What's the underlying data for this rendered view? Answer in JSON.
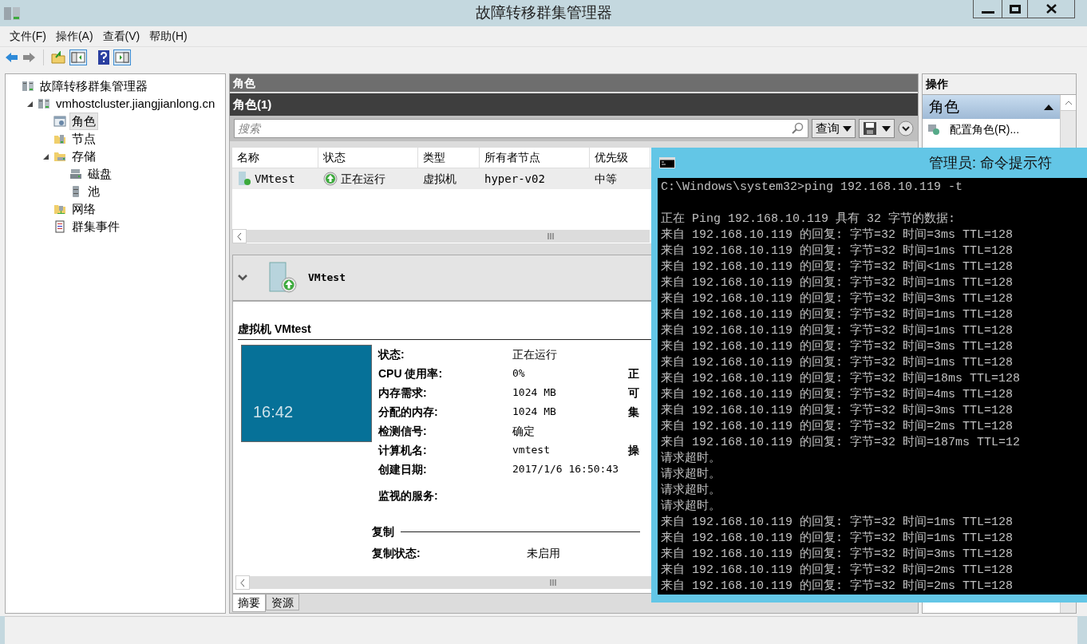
{
  "window": {
    "title": "故障转移群集管理器"
  },
  "menu": [
    "文件(F)",
    "操作(A)",
    "查看(V)",
    "帮助(H)"
  ],
  "tree": {
    "label": "故障转移群集管理器",
    "kind": "root",
    "selected": false,
    "children": [
      {
        "label": "vmhostcluster.jiangjianlong.cn",
        "kind": "cluster",
        "selected": false,
        "expanded": true,
        "children": [
          {
            "label": "角色",
            "kind": "roles",
            "selected": true
          },
          {
            "label": "节点",
            "kind": "nodes",
            "selected": false
          },
          {
            "label": "存储",
            "kind": "storage",
            "selected": false,
            "expanded": true,
            "children": [
              {
                "label": "磁盘",
                "kind": "disk",
                "selected": false
              },
              {
                "label": "池",
                "kind": "pool",
                "selected": false
              }
            ]
          },
          {
            "label": "网络",
            "kind": "network",
            "selected": false
          },
          {
            "label": "群集事件",
            "kind": "events",
            "selected": false
          }
        ]
      }
    ]
  },
  "roles_pane": {
    "title": "角色",
    "list_title": "角色(1)",
    "search": {
      "placeholder": "搜索"
    },
    "query_button": "查询",
    "columns": [
      "名称",
      "状态",
      "类型",
      "所有者节点",
      "优先级"
    ],
    "rows": [
      {
        "cells": [
          "VMtest",
          "正在运行",
          "虚拟机",
          "hyper-v02",
          "中等"
        ],
        "selected": false
      }
    ]
  },
  "details": {
    "name": "VMtest",
    "heading": "虚拟机 VMtest",
    "preview_time": "16:42",
    "fields": [
      {
        "label": "状态:",
        "value": "正在运行"
      },
      {
        "label": "CPU 使用率:",
        "value": "0%",
        "side": "正"
      },
      {
        "label": "内存需求:",
        "value": "1024 MB",
        "side": "可"
      },
      {
        "label": "分配的内存:",
        "value": "1024 MB",
        "side": "集"
      },
      {
        "label": "检测信号:",
        "value": "确定"
      },
      {
        "label": "计算机名:",
        "value": "vmtest",
        "side": "操"
      },
      {
        "label": "创建日期:",
        "value": "2017/1/6 16:50:43"
      }
    ],
    "monitored_label": "监视的服务:",
    "replication": {
      "title": "复制",
      "label": "复制状态:",
      "value": "未启用"
    },
    "tabs": [
      {
        "label": "摘要",
        "selected": true
      },
      {
        "label": "资源",
        "selected": false
      }
    ]
  },
  "actions": {
    "title": "操作",
    "section": "角色",
    "items": [
      "配置角色(R)..."
    ]
  },
  "cmd": {
    "title": "管理员: 命令提示符",
    "lines": [
      "C:\\Windows\\system32>ping 192.168.10.119 -t",
      "正在 Ping 192.168.10.119 具有 32 字节的数据:",
      "来自 192.168.10.119 的回复: 字节=32 时间=3ms TTL=128",
      "来自 192.168.10.119 的回复: 字节=32 时间=1ms TTL=128",
      "来自 192.168.10.119 的回复: 字节=32 时间<1ms TTL=128",
      "来自 192.168.10.119 的回复: 字节=32 时间=1ms TTL=128",
      "来自 192.168.10.119 的回复: 字节=32 时间=3ms TTL=128",
      "来自 192.168.10.119 的回复: 字节=32 时间=1ms TTL=128",
      "来自 192.168.10.119 的回复: 字节=32 时间=1ms TTL=128",
      "来自 192.168.10.119 的回复: 字节=32 时间=3ms TTL=128",
      "来自 192.168.10.119 的回复: 字节=32 时间=1ms TTL=128",
      "来自 192.168.10.119 的回复: 字节=32 时间=18ms TTL=128",
      "来自 192.168.10.119 的回复: 字节=32 时间=4ms TTL=128",
      "来自 192.168.10.119 的回复: 字节=32 时间=3ms TTL=128",
      "来自 192.168.10.119 的回复: 字节=32 时间=2ms TTL=128",
      "来自 192.168.10.119 的回复: 字节=32 时间=187ms TTL=12",
      "请求超时。",
      "请求超时。",
      "请求超时。",
      "请求超时。",
      "来自 192.168.10.119 的回复: 字节=32 时间=1ms TTL=128",
      "来自 192.168.10.119 的回复: 字节=32 时间=1ms TTL=128",
      "来自 192.168.10.119 的回复: 字节=32 时间=3ms TTL=128",
      "来自 192.168.10.119 的回复: 字节=32 时间=2ms TTL=128",
      "来自 192.168.10.119 的回复: 字节=32 时间=2ms TTL=128"
    ]
  }
}
